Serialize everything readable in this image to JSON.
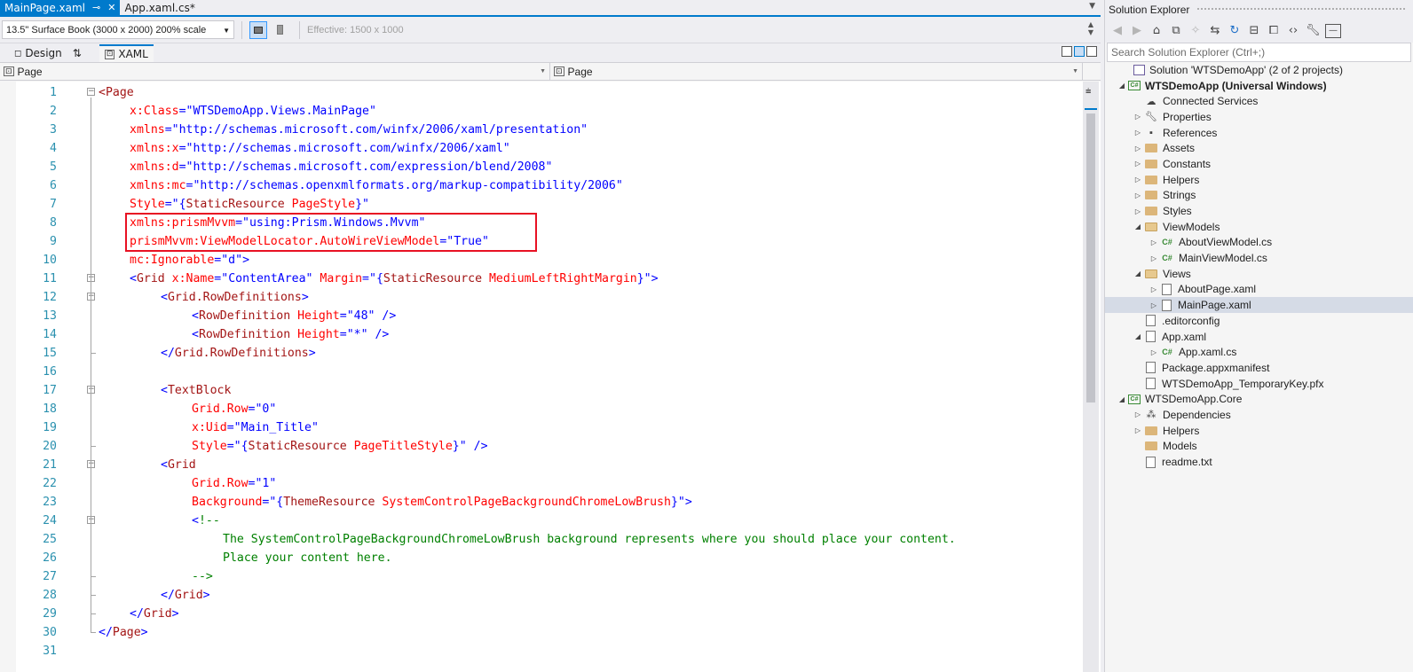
{
  "tabs": [
    {
      "label": "MainPage.xaml",
      "active": true
    },
    {
      "label": "App.xaml.cs*",
      "active": false
    }
  ],
  "toolbar": {
    "device": "13.5\" Surface Book (3000 x 2000) 200% scale",
    "effective": "Effective: 1500 x 1000"
  },
  "view_tabs": {
    "design": "Design",
    "xaml": "XAML"
  },
  "nav": {
    "left": "Page",
    "right": "Page"
  },
  "code_lines": [
    [
      [
        "tag",
        "<Page"
      ]
    ],
    [
      [
        "attr",
        "x:Class"
      ],
      [
        "br",
        "="
      ],
      [
        "val",
        "\"WTSDemoApp.Views.MainPage\""
      ]
    ],
    [
      [
        "attr",
        "xmlns"
      ],
      [
        "br",
        "="
      ],
      [
        "val",
        "\"http://schemas.microsoft.com/winfx/2006/xaml/presentation\""
      ]
    ],
    [
      [
        "attr",
        "xmlns:x"
      ],
      [
        "br",
        "="
      ],
      [
        "val",
        "\"http://schemas.microsoft.com/winfx/2006/xaml\""
      ]
    ],
    [
      [
        "attr",
        "xmlns:d"
      ],
      [
        "br",
        "="
      ],
      [
        "val",
        "\"http://schemas.microsoft.com/expression/blend/2008\""
      ]
    ],
    [
      [
        "attr",
        "xmlns:mc"
      ],
      [
        "br",
        "="
      ],
      [
        "val",
        "\"http://schemas.openxmlformats.org/markup-compatibility/2006\""
      ]
    ],
    [
      [
        "attr",
        "Style"
      ],
      [
        "br",
        "="
      ],
      [
        "val",
        "\"{"
      ],
      [
        "tag",
        "StaticResource"
      ],
      [
        "attr",
        " PageStyle"
      ],
      [
        "val",
        "}\""
      ]
    ],
    [
      [
        "attr",
        "xmlns:prismMvvm"
      ],
      [
        "br",
        "="
      ],
      [
        "val",
        "\"using:Prism.Windows.Mvvm\""
      ]
    ],
    [
      [
        "attr",
        "prismMvvm:ViewModelLocator.AutoWireViewModel"
      ],
      [
        "br",
        "="
      ],
      [
        "val",
        "\"True\""
      ]
    ],
    [
      [
        "attr",
        "mc:Ignorable"
      ],
      [
        "br",
        "="
      ],
      [
        "val",
        "\"d\""
      ],
      [
        "br",
        ">"
      ]
    ],
    [
      [
        "br",
        "<"
      ],
      [
        "tag",
        "Grid"
      ],
      [
        "attr",
        " x:Name"
      ],
      [
        "br",
        "="
      ],
      [
        "val",
        "\"ContentArea\""
      ],
      [
        "attr",
        " Margin"
      ],
      [
        "br",
        "="
      ],
      [
        "val",
        "\"{"
      ],
      [
        "tag",
        "StaticResource"
      ],
      [
        "attr",
        " MediumLeftRightMargin"
      ],
      [
        "val",
        "}\""
      ],
      [
        "br",
        ">"
      ]
    ],
    [
      [
        "br",
        "<"
      ],
      [
        "tag",
        "Grid.RowDefinitions"
      ],
      [
        "br",
        ">"
      ]
    ],
    [
      [
        "br",
        "<"
      ],
      [
        "tag",
        "RowDefinition"
      ],
      [
        "attr",
        " Height"
      ],
      [
        "br",
        "="
      ],
      [
        "val",
        "\"48\""
      ],
      [
        "br",
        " />"
      ]
    ],
    [
      [
        "br",
        "<"
      ],
      [
        "tag",
        "RowDefinition"
      ],
      [
        "attr",
        " Height"
      ],
      [
        "br",
        "="
      ],
      [
        "val",
        "\"*\""
      ],
      [
        "br",
        " />"
      ]
    ],
    [
      [
        "br",
        "</"
      ],
      [
        "tag",
        "Grid.RowDefinitions"
      ],
      [
        "br",
        ">"
      ]
    ],
    [],
    [
      [
        "br",
        "<"
      ],
      [
        "tag",
        "TextBlock"
      ]
    ],
    [
      [
        "attr",
        "Grid.Row"
      ],
      [
        "br",
        "="
      ],
      [
        "val",
        "\"0\""
      ]
    ],
    [
      [
        "attr",
        "x:Uid"
      ],
      [
        "br",
        "="
      ],
      [
        "val",
        "\"Main_Title\""
      ]
    ],
    [
      [
        "attr",
        "Style"
      ],
      [
        "br",
        "="
      ],
      [
        "val",
        "\"{"
      ],
      [
        "tag",
        "StaticResource"
      ],
      [
        "attr",
        " PageTitleStyle"
      ],
      [
        "val",
        "}\""
      ],
      [
        "br",
        " />"
      ]
    ],
    [
      [
        "br",
        "<"
      ],
      [
        "tag",
        "Grid"
      ]
    ],
    [
      [
        "attr",
        "Grid.Row"
      ],
      [
        "br",
        "="
      ],
      [
        "val",
        "\"1\""
      ]
    ],
    [
      [
        "attr",
        "Background"
      ],
      [
        "br",
        "="
      ],
      [
        "val",
        "\"{"
      ],
      [
        "tag",
        "ThemeResource"
      ],
      [
        "attr",
        " SystemControlPageBackgroundChromeLowBrush"
      ],
      [
        "val",
        "}\""
      ],
      [
        "br",
        ">"
      ]
    ],
    [
      [
        "br",
        "<"
      ],
      [
        "comment",
        "!--"
      ]
    ],
    [
      [
        "comment",
        "The SystemControlPageBackgroundChromeLowBrush background represents where you should place your content."
      ]
    ],
    [
      [
        "comment",
        "Place your content here."
      ]
    ],
    [
      [
        "comment",
        "-->"
      ]
    ],
    [
      [
        "br",
        "</"
      ],
      [
        "tag",
        "Grid"
      ],
      [
        "br",
        ">"
      ]
    ],
    [
      [
        "br",
        "</"
      ],
      [
        "tag",
        "Grid"
      ],
      [
        "br",
        ">"
      ]
    ],
    [
      [
        "br",
        "</"
      ],
      [
        "tag",
        "Page"
      ],
      [
        "br",
        ">"
      ]
    ],
    []
  ],
  "solution_explorer": {
    "title": "Solution Explorer",
    "search_placeholder": "Search Solution Explorer (Ctrl+;)",
    "nodes": [
      {
        "label": "Solution 'WTSDemoApp' (2 of 2 projects)",
        "icon": "solution-icon",
        "level": 0,
        "arrow": "",
        "bold": false,
        "selected": false
      },
      {
        "label": "WTSDemoApp (Universal Windows)",
        "icon": "csharp-project-icon",
        "level": 0,
        "arrow": "expanded",
        "bold": true,
        "selected": false
      },
      {
        "label": "Connected Services",
        "icon": "cloud-icon",
        "level": 1,
        "arrow": "",
        "bold": false,
        "selected": false
      },
      {
        "label": "Properties",
        "icon": "wrench-icon",
        "level": 1,
        "arrow": "collapsed",
        "bold": false,
        "selected": false
      },
      {
        "label": "References",
        "icon": "references-icon",
        "level": 1,
        "arrow": "collapsed",
        "bold": false,
        "selected": false
      },
      {
        "label": "Assets",
        "icon": "folder-icon",
        "level": 1,
        "arrow": "collapsed",
        "bold": false,
        "selected": false
      },
      {
        "label": "Constants",
        "icon": "folder-icon",
        "level": 1,
        "arrow": "collapsed",
        "bold": false,
        "selected": false
      },
      {
        "label": "Helpers",
        "icon": "folder-icon",
        "level": 1,
        "arrow": "collapsed",
        "bold": false,
        "selected": false
      },
      {
        "label": "Strings",
        "icon": "folder-icon",
        "level": 1,
        "arrow": "collapsed",
        "bold": false,
        "selected": false
      },
      {
        "label": "Styles",
        "icon": "folder-icon",
        "level": 1,
        "arrow": "collapsed",
        "bold": false,
        "selected": false
      },
      {
        "label": "ViewModels",
        "icon": "folder-open-icon",
        "level": 1,
        "arrow": "expanded",
        "bold": false,
        "selected": false
      },
      {
        "label": "AboutViewModel.cs",
        "icon": "csharp-file-icon",
        "level": 2,
        "arrow": "collapsed",
        "bold": false,
        "selected": false
      },
      {
        "label": "MainViewModel.cs",
        "icon": "csharp-file-icon",
        "level": 2,
        "arrow": "collapsed",
        "bold": false,
        "selected": false
      },
      {
        "label": "Views",
        "icon": "folder-open-icon",
        "level": 1,
        "arrow": "expanded",
        "bold": false,
        "selected": false
      },
      {
        "label": "AboutPage.xaml",
        "icon": "xaml-file-icon",
        "level": 2,
        "arrow": "collapsed",
        "bold": false,
        "selected": false
      },
      {
        "label": "MainPage.xaml",
        "icon": "xaml-file-icon",
        "level": 2,
        "arrow": "collapsed",
        "bold": false,
        "selected": true
      },
      {
        "label": ".editorconfig",
        "icon": "file-icon",
        "level": 1,
        "arrow": "",
        "bold": false,
        "selected": false
      },
      {
        "label": "App.xaml",
        "icon": "xaml-file-icon",
        "level": 1,
        "arrow": "expanded",
        "bold": false,
        "selected": false
      },
      {
        "label": "App.xaml.cs",
        "icon": "csharp-file-icon",
        "level": 2,
        "arrow": "collapsed",
        "bold": false,
        "selected": false
      },
      {
        "label": "Package.appxmanifest",
        "icon": "manifest-icon",
        "level": 1,
        "arrow": "",
        "bold": false,
        "selected": false
      },
      {
        "label": "WTSDemoApp_TemporaryKey.pfx",
        "icon": "certificate-icon",
        "level": 1,
        "arrow": "",
        "bold": false,
        "selected": false
      },
      {
        "label": "WTSDemoApp.Core",
        "icon": "csharp-project-icon",
        "level": 0,
        "arrow": "expanded",
        "bold": false,
        "selected": false
      },
      {
        "label": "Dependencies",
        "icon": "dependencies-icon",
        "level": 1,
        "arrow": "collapsed",
        "bold": false,
        "selected": false
      },
      {
        "label": "Helpers",
        "icon": "folder-icon",
        "level": 1,
        "arrow": "collapsed",
        "bold": false,
        "selected": false
      },
      {
        "label": "Models",
        "icon": "folder-icon",
        "level": 1,
        "arrow": "",
        "bold": false,
        "selected": false
      },
      {
        "label": "readme.txt",
        "icon": "text-file-icon",
        "level": 1,
        "arrow": "",
        "bold": false,
        "selected": false
      }
    ]
  },
  "colors": {
    "accent": "#007acc",
    "line_number": "#2b91af",
    "xml_tag": "#a31515",
    "xml_attribute": "#ff0000",
    "xml_value": "#0000ff",
    "comment": "#008000",
    "highlight_box": "#e81123"
  }
}
